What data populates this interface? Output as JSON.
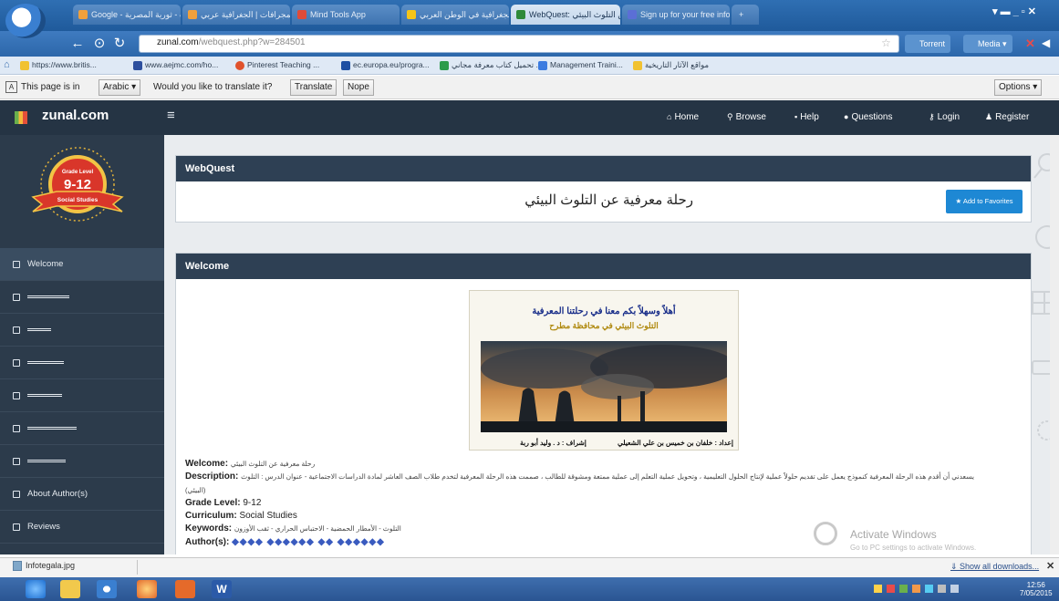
{
  "browser": {
    "tabs": [
      {
        "label": "Google - عبث - ثورية المصرية",
        "color": "#f0a03c"
      },
      {
        "label": "الاتراث المجرافات | الجغرافية عربي",
        "color": "#f0a03c"
      },
      {
        "label": "Mind Tools App",
        "color": "#e04b3a"
      },
      {
        "label": "الجغرافية في الوطن العربي",
        "color": "#f5c518"
      },
      {
        "label": "WebQuest: من التلوث البيئي",
        "color": "#2f8a3a",
        "active": true
      },
      {
        "label": "Sign up for your free infog",
        "color": "#5b6fd6"
      }
    ],
    "window_controls": "▾ ▬ _ ▫ ✕",
    "url_domain": "zunal.com",
    "url_path": "/webquest.php?w=284501",
    "toolbar_right": [
      "Torrent",
      "Media ▾"
    ],
    "bookmarks": [
      {
        "label": "https://www.britis...",
        "color": "#f1c232"
      },
      {
        "label": "www.aejmc.com/ho...",
        "color": "#2d4f9e"
      },
      {
        "label": "Pinterest Teaching ...",
        "color": "#e0522d"
      },
      {
        "label": "ec.europa.eu/progra...",
        "color": "#1d4fa3"
      },
      {
        "label": "تحميل كتاب معرفة مجاني ...",
        "color": "#2c9b4b"
      },
      {
        "label": "Management Traini...",
        "color": "#3b7be0"
      },
      {
        "label": "مواقع الآثار التاريخية",
        "color": "#f1c232"
      }
    ],
    "translate_bar": {
      "prefix": "This page is in",
      "language": "Arabic ▾",
      "question": "Would you like to translate it?",
      "translate_btn": "Translate",
      "nope_btn": "Nope",
      "options_btn": "Options ▾"
    }
  },
  "site": {
    "name": "zunal.com",
    "hamburger": "≡",
    "menu": [
      {
        "icon": "⌂",
        "label": "Home"
      },
      {
        "icon": "⚲",
        "label": "Browse"
      },
      {
        "icon": "▪",
        "label": "Help"
      },
      {
        "icon": "●",
        "label": "Questions"
      },
      {
        "icon": "⚷",
        "label": "Login"
      },
      {
        "icon": "♟",
        "label": "Register"
      }
    ]
  },
  "sidebar": {
    "badge_title": "Grade Level",
    "badge_grade": "9-12",
    "badge_subject": "Social Studies",
    "items": [
      {
        "label": "Welcome",
        "active": true
      },
      {
        "label": "المقدمة",
        "scribble": 60
      },
      {
        "label": "المهام",
        "scribble": 30
      },
      {
        "label": "العمليات",
        "scribble": 46
      },
      {
        "label": "التقييم",
        "scribble": 44
      },
      {
        "label": "الاستنتاجات",
        "scribble": 70
      },
      {
        "label": "صفحة المعلم",
        "scribble": 48
      },
      {
        "label": "About Author(s)"
      },
      {
        "label": "Reviews"
      }
    ]
  },
  "main": {
    "webquest_panel_title": "WebQuest",
    "webquest_title": "رحلة معرفية عن التلوث البيئي",
    "add_favorites": "★ Add to Favorites",
    "welcome_panel_title": "Welcome",
    "poster": {
      "line1": "أهلاً وسهلاً بكم معنا في رحلتنا المعرفية",
      "line2": "التلوث البيئي في محافظة مطرح",
      "footer_prep": "إعداد : خلفان بن خميس بن علي الشعيلي",
      "footer_super": "إشراف : د . وليد أبو ربة"
    },
    "meta": {
      "welcome_label": "Welcome:",
      "welcome_value": "رحلة معرفية عن التلوث البيئي",
      "description_label": "Description:",
      "description_value": "يسعدني أن أقدم هذه الرحلة المعرفية كنموذج يعمل على تقديم حلولاً عملية لإنتاج الحلول التعليمية ، وتحويل عملية التعلم إلى عملية ممتعة ومشوقة للطالب ، صممت هذه الرحلة المعرفية لتخدم طلاب الصف العاشر لمادة الدراسات الاجتماعية - عنوان الدرس : التلوث",
      "description_cont": "(البيئي)",
      "grade_label": "Grade Level:",
      "grade_value": "9-12",
      "curriculum_label": "Curriculum:",
      "curriculum_value": "Social Studies",
      "keywords_label": "Keywords:",
      "keywords_value": "التلوث - الأمطار الحمضية - الاحتباس الحراري - ثقب الأوزون",
      "authors_label": "Author(s):",
      "authors_value": "◆◆◆◆ ◆◆◆◆◆◆ ◆◆ ◆◆◆◆◆◆"
    }
  },
  "watermark": {
    "title": "Activate Windows",
    "sub": "Go to PC settings to activate Windows."
  },
  "downloads": {
    "file": "Infotegala.jpg",
    "show_all": "⇓ Show all downloads...",
    "close": "✕"
  },
  "taskbar": {
    "time": "12:56",
    "date": "7/05/2015"
  }
}
